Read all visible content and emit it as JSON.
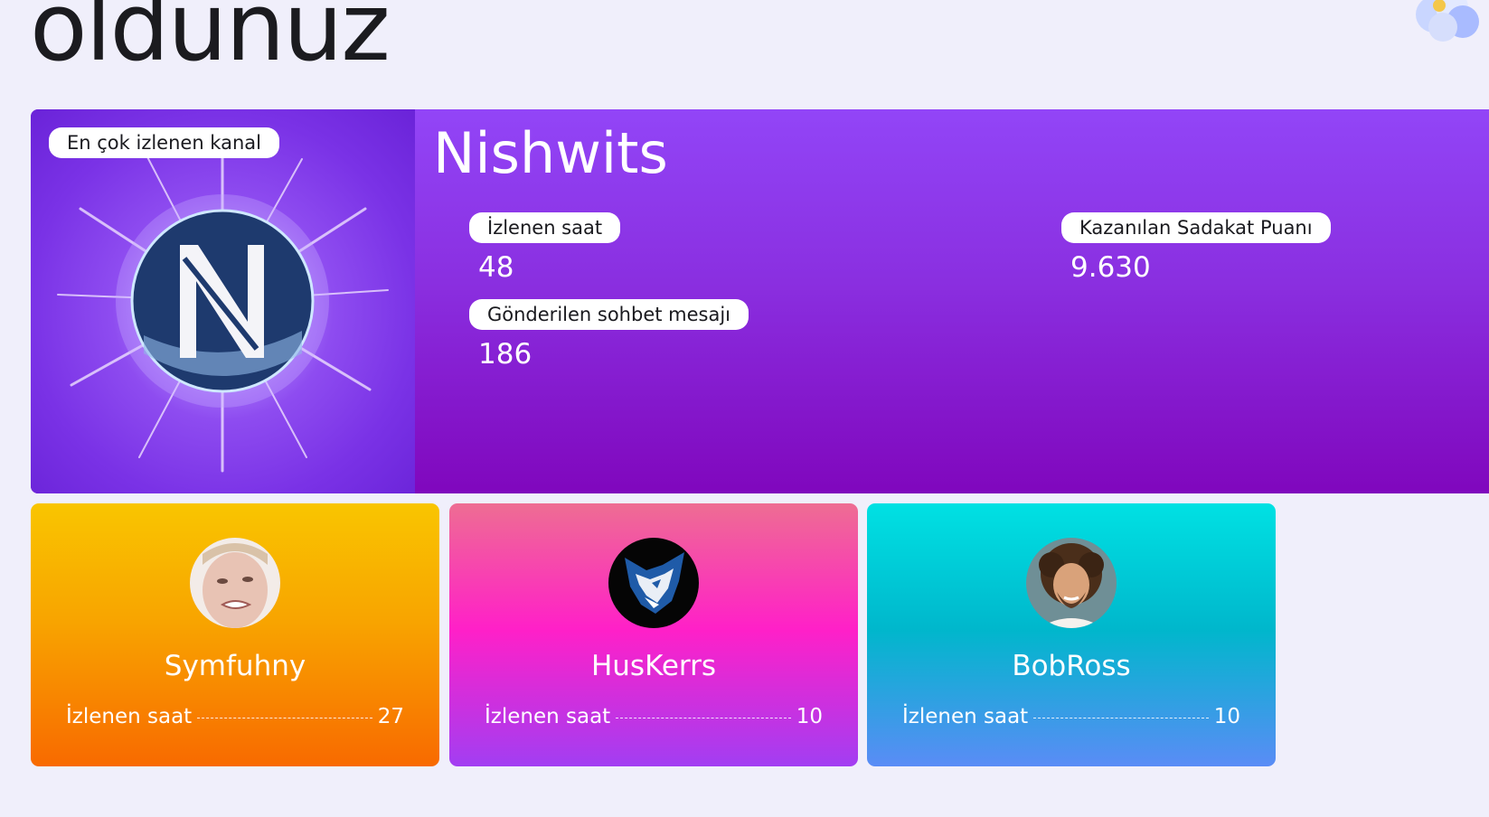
{
  "heading": "oldunuz",
  "top_channel": {
    "badge": "En çok izlenen kanal",
    "name": "Nishwits",
    "stats": [
      {
        "label": "İzlenen saat",
        "value": "48"
      },
      {
        "label": "Kazanılan Sadakat Puanı",
        "value": "9.630"
      },
      {
        "label": "Gönderilen sohbet mesajı",
        "value": "186"
      }
    ]
  },
  "channels": [
    {
      "name": "Symfuhny",
      "stat_label": "İzlenen saat",
      "stat_value": "27"
    },
    {
      "name": "HusKerrs",
      "stat_label": "İzlenen saat",
      "stat_value": "10"
    },
    {
      "name": "BobRoss",
      "stat_label": "İzlenen saat",
      "stat_value": "10"
    }
  ],
  "colors": {
    "background": "#f0effb",
    "hero_gradient_top": "#9245f7",
    "hero_gradient_bottom": "#8007bd",
    "card_1_top": "#f9c500",
    "card_1_bottom": "#f86a00",
    "card_2_top": "#ee6d93",
    "card_2_bottom": "#a23ef2",
    "card_3_top": "#00e1e3",
    "card_3_bottom": "#5a8cf6"
  }
}
